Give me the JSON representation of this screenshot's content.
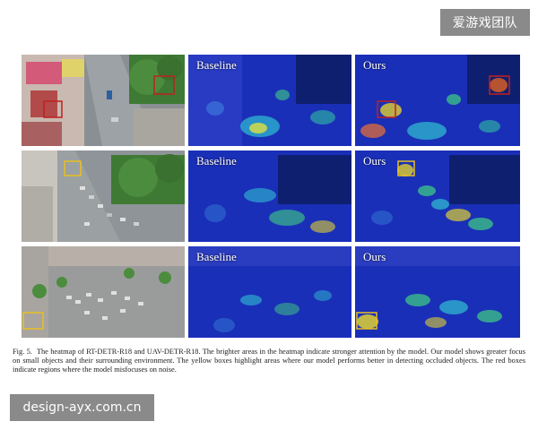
{
  "watermark_top": "爱游戏团队",
  "watermark_bottom": "design-ayx.com.cn",
  "figure": {
    "panel_labels": {
      "baseline": "Baseline",
      "ours": "Ours"
    },
    "colors": {
      "heatmap_base": "#1a2fb8",
      "highlight_yellow": "#e8c020",
      "misfocus_red": "#c02020"
    }
  },
  "caption": {
    "figure_number": "Fig. 5.",
    "text": "The heatmap of RT-DETR-R18 and UAV-DETR-R18. The brighter areas in the heatmap indicate stronger attention by the model. Our model shows greater focus on small objects and their surrounding environment. The yellow boxes highlight areas where our model performs better in detecting occluded objects. The red boxes indicate regions where the model misfocuses on noise."
  }
}
